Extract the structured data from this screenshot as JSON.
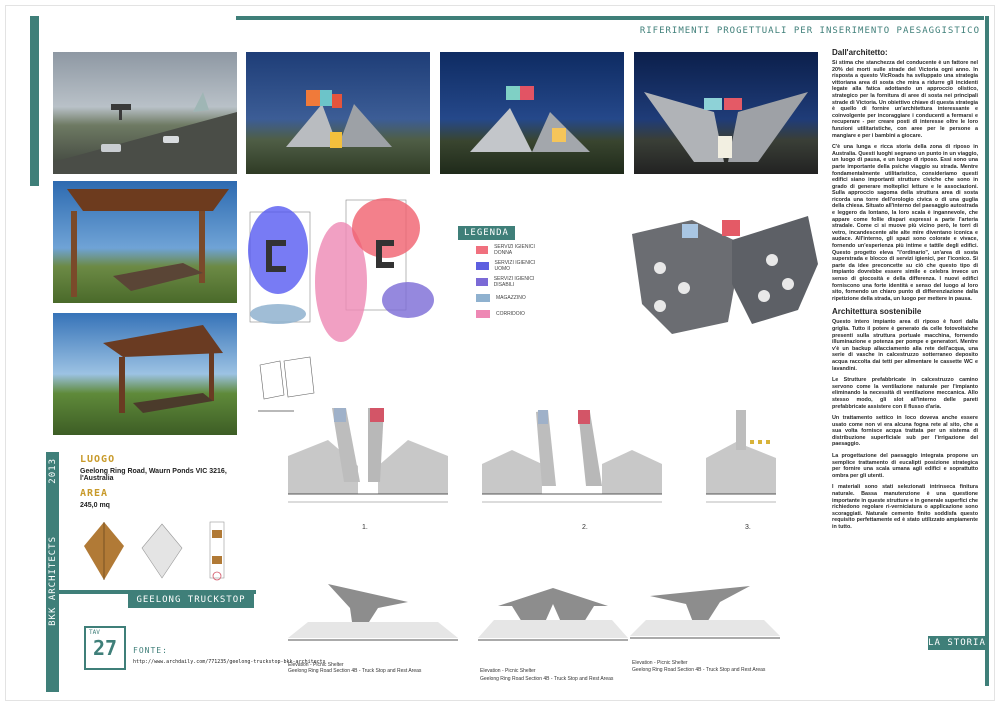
{
  "header": {
    "title": "RIFERIMENTI PROGETTUALI PER INSERIMENTO PAESAGGISTICO"
  },
  "legend": {
    "title": "LEGENDA",
    "items": [
      {
        "label": "SERVIZI IGIENICI DONNA",
        "color": "#f0707e"
      },
      {
        "label": "SERVIZI IGIENICI UOMO",
        "color": "#5d5fe0"
      },
      {
        "label": "SERVIZI IGIENICI DISABILI",
        "color": "#7b6ad6"
      },
      {
        "label": "MAGAZZINO",
        "color": "#8fb1cf"
      },
      {
        "label": "CORRIDOIO",
        "color": "#ee88b4"
      }
    ]
  },
  "luogo": {
    "label": "LUOGO",
    "value": "Geelong Ring Road, Waurn Ponds VIC 3216, l'Australia"
  },
  "area": {
    "label": "AREA",
    "value": "245,0 mq"
  },
  "vertical": {
    "year": "2013",
    "architects": "BKK ARCHITECTS"
  },
  "project_title": "GEELONG TRUCKSTOP",
  "tav": {
    "label": "TAV",
    "number": "27"
  },
  "fonte": {
    "label": "FONTE:",
    "url": "http://www.archdaily.com/771235/geelong-truckstop-bkk-architects"
  },
  "sections": {
    "n1": "1.",
    "n2": "2.",
    "n3": "3."
  },
  "elevation_captions": {
    "c1a": "Elevation - Picnic Shelter",
    "c1b": "Geelong Ring Road Section 4B - Truck Stop and Rest Areas",
    "c2a": "Elevation - Picnic Shelter",
    "c2b": "Geelong Ring Road Section 4B - Truck Stop and Rest Areas",
    "c3a": "Elevation - Picnic Shelter",
    "c3b": "Geelong Ring Road Section 4B - Truck Stop and Rest Areas"
  },
  "text": {
    "h1": "Dall'architetto:",
    "p1": "Si stima che stanchezza del conducente è un fattore nel 20% dei morti sulle strade del Victoria ogni anno. In risposta a questo VicRoads ha sviluppato una strategia vittoriana area di sosta che mira a ridurre gli incidenti legate alla fatica adottando un approccio olistico, strategico per la fornitura di aree di sosta nei principali strade di Victoria. Un obiettivo chiave di questa strategia è quello di fornire un'architettura interessante e coinvolgente per incoraggiare i conducenti a fermarsi e recuperare - per creare posti di interesse oltre le loro funzioni utilitaristiche, con aree per le persone a mangiare e per i bambini a giocare.",
    "p2": "C'è una lunga e ricca storia della zona di riposo in Australia. Questi luoghi segnano un punto in un viaggio, un luogo di pausa, e un luogo di riposo. Essi sono una parte importante della psiche viaggio su strada. Mentre fondamentalmente utilitaristico, consideriamo questi edifici siano importanti strutture civiche che sono in grado di generare molteplici letture e le associazioni. Sulla approccio sagoma della struttura area di sosta ricorda una torre dell'orologio civica o di una guglia della chiesa. Situato all'interno del paesaggio autostrada e leggero da lontano, la loro scala è ingannevole, che appare come follie dispari espressi a parte l'arteria stradale. Come ci si muove più vicino però, le torri di vetro, incandescente alte alte mire diventano iconica e audace. All'interno, gli spazi sono colorate e vivace, fornendo un'esperienza più intime e tattile degli edifici. Questo progetto eleva \"l'ordinario\", un'area di sosta superstrada e blocco di servizi igienici, per l'iconico. Si parte da idee preconcette su ciò che questo tipo di impianto dovrebbe essere simile e celebra invece un senso di giocosità e della differenza. I nuovi edifici forniscono una forte identità e senso del luogo al loro sito, fornendo un chiaro punto di differenziazione dalla ripetizione della strada, un luogo per mettere in pausa.",
    "h2": "Architettura sostenibile",
    "p3": "Questo intero impianto area di riposo è fuori dalla griglia. Tutto il potere è generato da celle fotovoltaiche presenti sulla struttura portuale macchina, fornendo illuminazione e potenza per pompe e generatori. Mentre v'è un backup allacciamento alla rete dell'acqua, una serie di vasche in calcestruzzo sotterraneo deposito acqua raccolta dai tetti per alimentare le cassette WC e lavandini.",
    "p4": "Le Strutture prefabbricate in calcestruzzo camino servono come la ventilazione naturale per l'impianto eliminando la necessità di ventilazione meccanica. Allo stesso modo, gli slot all'interno delle pareti prefabbricate assistere con il flusso d'aria.",
    "p5": "Un trattamento settico in loco doveva anche essere usato come non vi era alcuna fogna rete al sito, che a sua volta fornisce acqua trattata per un sistema di distribuzione superficiale sub per l'irrigazione del paesaggio.",
    "p6": "La progettazione del paesaggio integrata propone un semplice trattamento di eucalipti posizione strategica per fornire una scala umana agli edifici e soprattutto ombra per gli utenti.",
    "p7": "I materiali sono stati selezionati intrinseca finitura naturale. Bassa manutenzione è una questione importante in queste strutture e in generale superfici che richiedono regolare ri-verniciatura o applicazione sono scoraggiati. Naturale cemento finito soddisfa questo requisito perfettamente ed è stato utilizzato ampiamente in tutto."
  },
  "storia": "LA STORIA"
}
